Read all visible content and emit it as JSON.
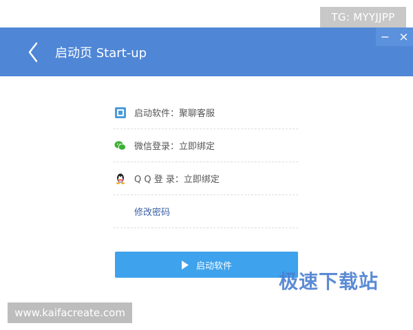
{
  "watermarks": {
    "tg": "TG: MYYJJPP",
    "brand": "极速下载站",
    "site": "www.kaifacreate.com"
  },
  "header": {
    "title": "启动页  Start-up",
    "back_icon": "chevron-left-icon",
    "window_controls": {
      "minimize": "−",
      "close": "×"
    }
  },
  "settings": {
    "items": [
      {
        "icon": "app-logo-icon",
        "label": "启动软件：聚聊客服"
      },
      {
        "icon": "wechat-icon",
        "label": "微信登录：立即绑定"
      },
      {
        "icon": "qq-icon",
        "label": "Q Q 登 录：立即绑定"
      },
      {
        "icon": "",
        "label": "修改密码"
      }
    ]
  },
  "actions": {
    "start_label": "启动软件",
    "start_icon": "play-icon"
  },
  "colors": {
    "header": "#4f86d6",
    "button": "#3ea2ec",
    "link": "#3b5fa8"
  }
}
